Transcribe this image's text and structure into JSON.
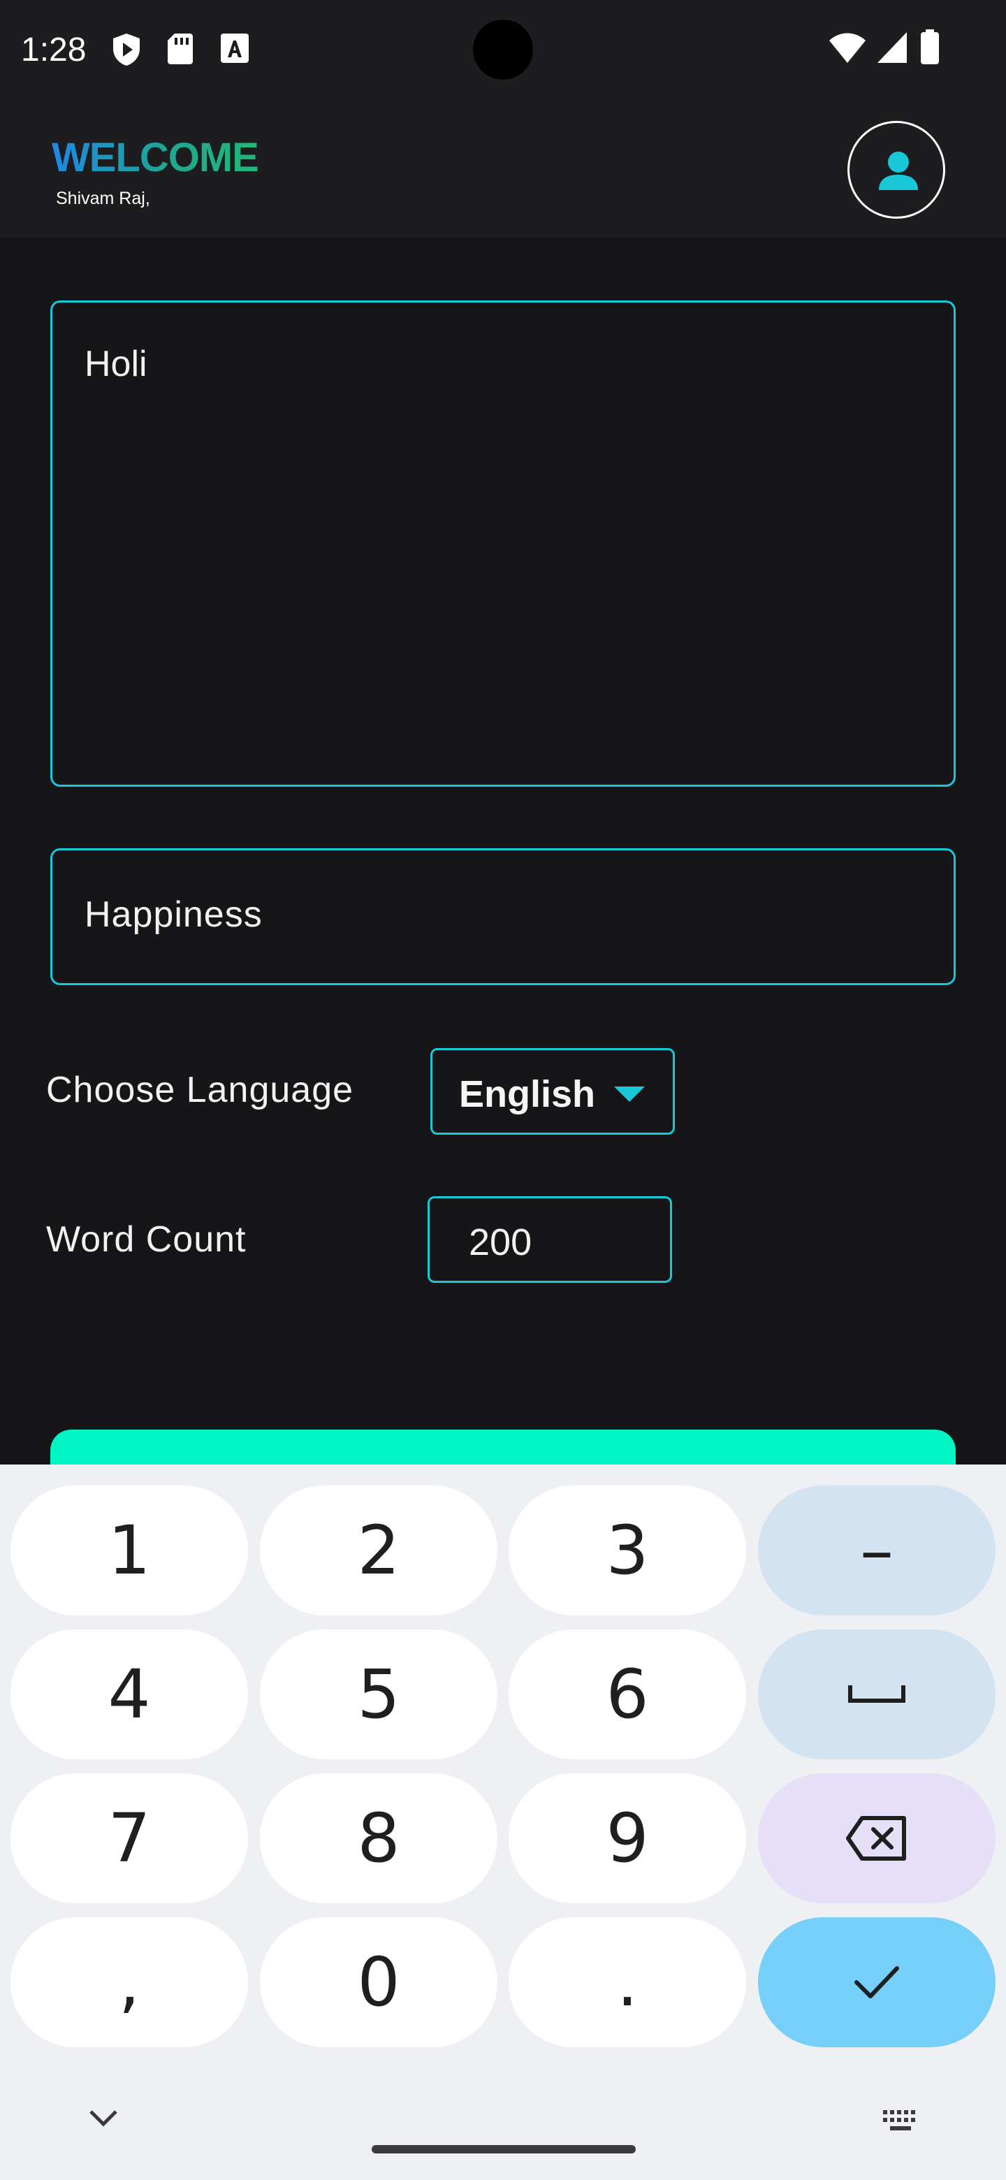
{
  "status_bar": {
    "time": "1:28",
    "icons": [
      "shield-play-icon",
      "sd-card-icon",
      "font-a-icon",
      "wifi-icon",
      "signal-icon",
      "battery-icon"
    ]
  },
  "header": {
    "welcome": "WELCOME",
    "user_name": "Shivam Raj,",
    "avatar_icon": "person-icon"
  },
  "form": {
    "topic_value": "Holi",
    "tone_value": "Happiness",
    "language_label": "Choose Language",
    "language_value": "English",
    "word_count_label": "Word Count",
    "word_count_value": "200"
  },
  "colors": {
    "accent": "#18c8d8",
    "button": "#00f5c4",
    "background": "#161618"
  },
  "keyboard": {
    "keys": [
      "1",
      "2",
      "3",
      "–",
      "4",
      "5",
      "6",
      "space-icon",
      "7",
      "8",
      "9",
      "backspace-icon",
      ",",
      "0",
      ".",
      "done-check-icon"
    ]
  }
}
